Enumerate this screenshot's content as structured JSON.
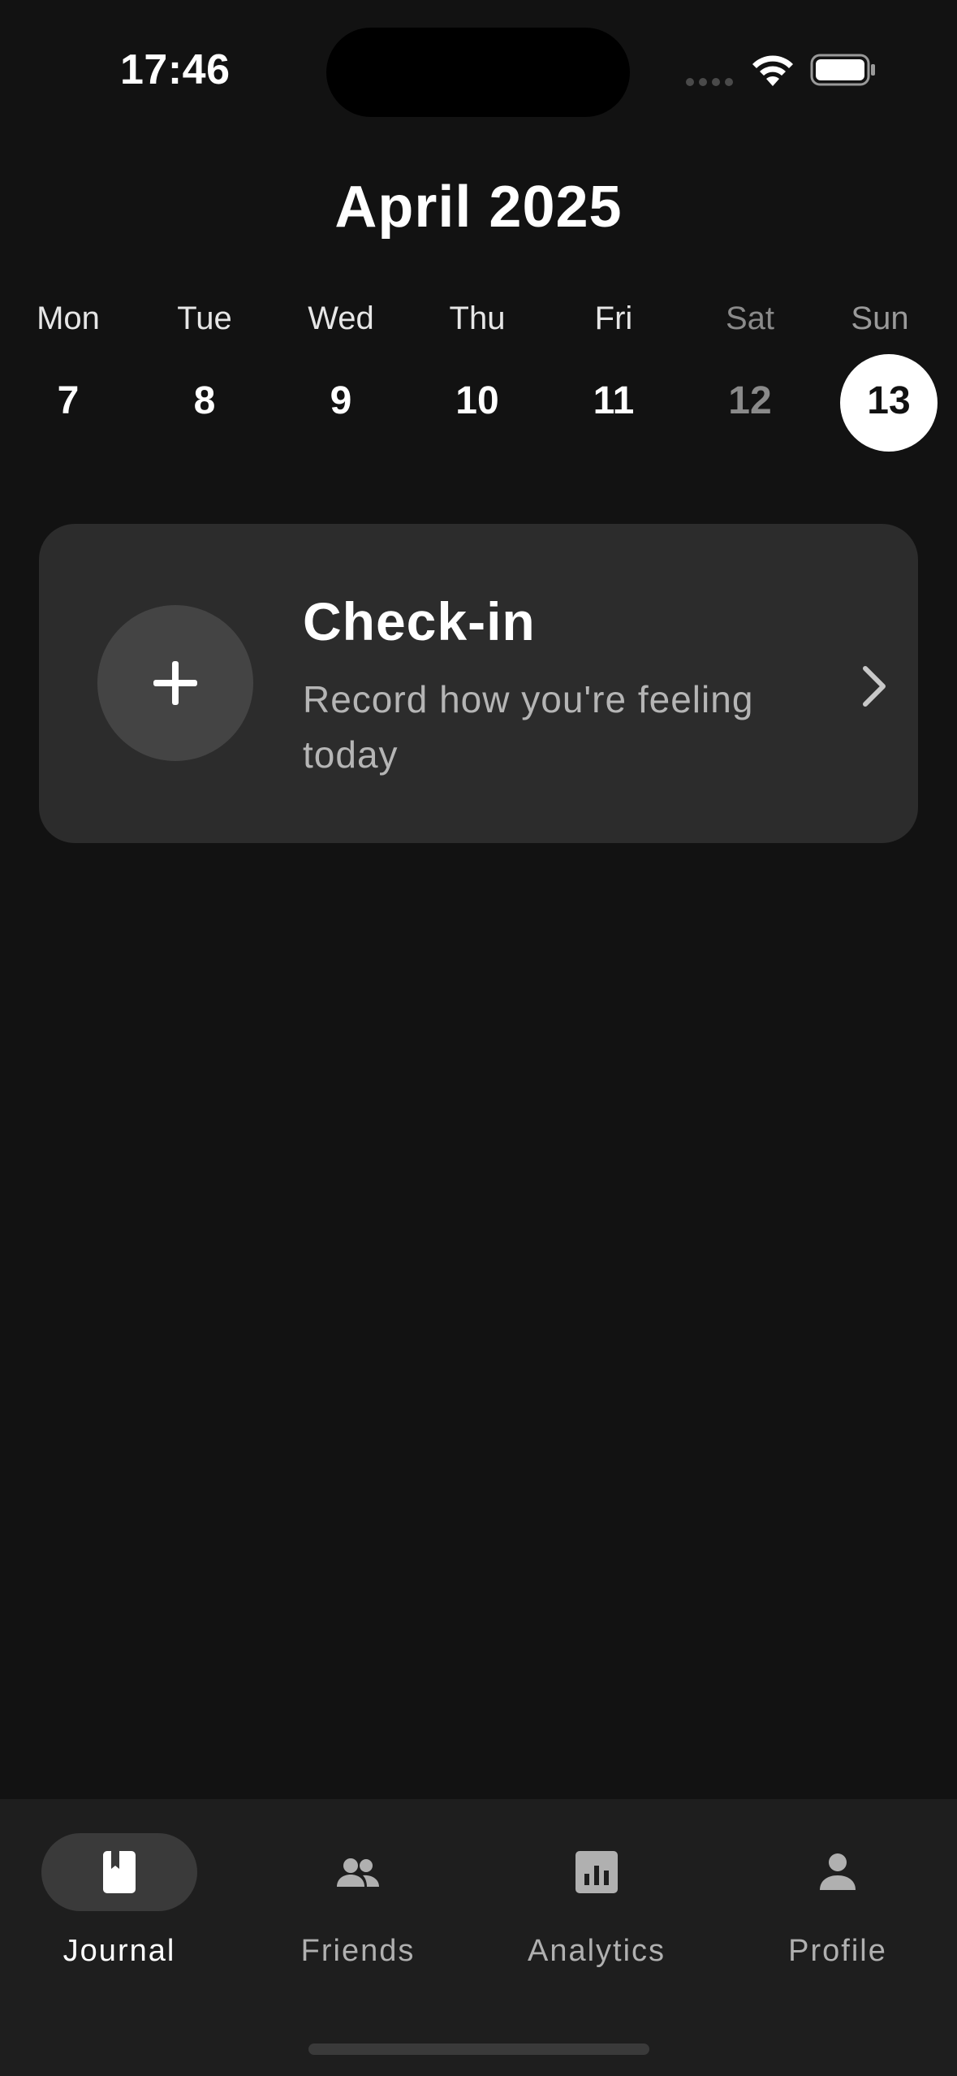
{
  "status_bar": {
    "time": "17:46"
  },
  "header": {
    "month_title": "April 2025"
  },
  "week": {
    "days": [
      {
        "name": "Mon",
        "number": "7"
      },
      {
        "name": "Tue",
        "number": "8"
      },
      {
        "name": "Wed",
        "number": "9"
      },
      {
        "name": "Thu",
        "number": "10"
      },
      {
        "name": "Fri",
        "number": "11"
      },
      {
        "name": "Sat",
        "number": "12"
      },
      {
        "name": "Sun",
        "number": "13"
      }
    ],
    "selected_day": "13"
  },
  "checkin_card": {
    "title": "Check-in",
    "subtitle": "Record how you're feeling today",
    "icon": "plus-icon",
    "chevron_icon": "chevron-right-icon"
  },
  "bottom_nav": {
    "items": [
      {
        "label": "Journal",
        "icon": "journal-book-icon",
        "active": true
      },
      {
        "label": "Friends",
        "icon": "people-icon",
        "active": false
      },
      {
        "label": "Analytics",
        "icon": "bar-chart-icon",
        "active": false
      },
      {
        "label": "Profile",
        "icon": "person-icon",
        "active": false
      }
    ]
  },
  "colors": {
    "background": "#121212",
    "card": "#2c2c2c",
    "nav_background": "#1e1e1e",
    "active_pill": "#3a3a3a",
    "selected_day_circle": "#ffffff"
  }
}
